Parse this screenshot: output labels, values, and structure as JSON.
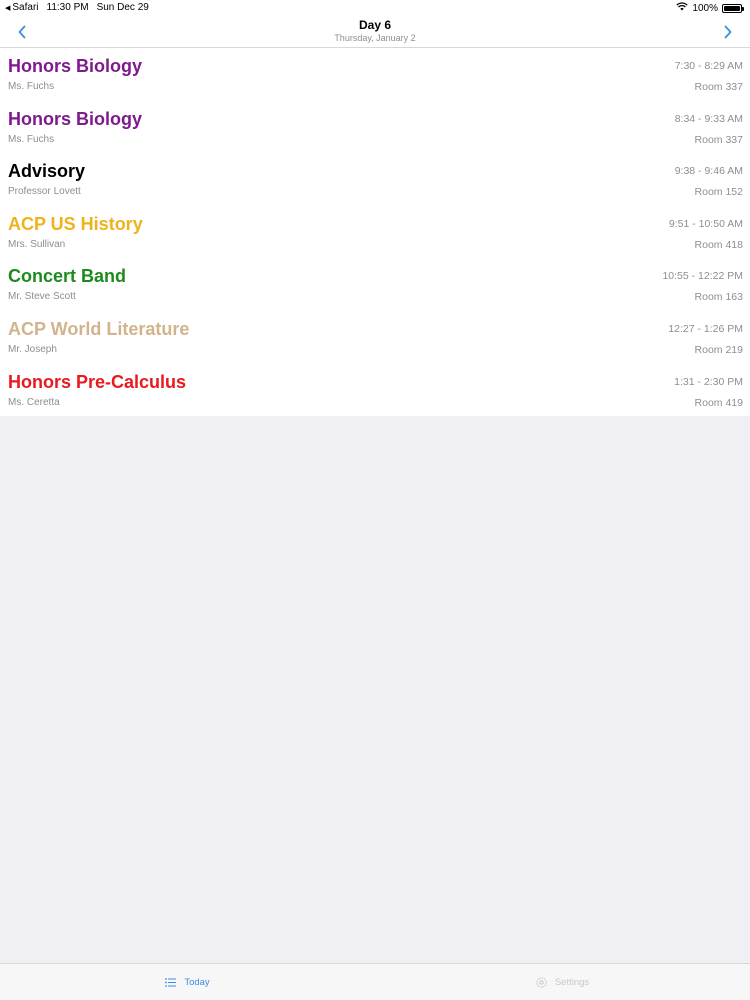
{
  "status_bar": {
    "back_app": "Safari",
    "time": "11:30 PM",
    "date": "Sun Dec 29",
    "battery": "100%",
    "battery_level": 1.0
  },
  "nav": {
    "title": "Day 6",
    "subtitle": "Thursday, January 2",
    "prev_icon": "chevron-left-icon",
    "next_icon": "chevron-right-icon",
    "accent_color": "#3f8de0"
  },
  "periods": [
    {
      "name": "Honors Biology",
      "teacher": "Ms. Fuchs",
      "time": "7:30 - 8:29 AM",
      "room": "Room 337",
      "color": "#7e1a8e"
    },
    {
      "name": "Honors Biology",
      "teacher": "Ms. Fuchs",
      "time": "8:34 - 9:33 AM",
      "room": "Room 337",
      "color": "#7e1a8e"
    },
    {
      "name": "Advisory",
      "teacher": "Professor Lovett",
      "time": "9:38 - 9:46 AM",
      "room": "Room 152",
      "color": "#000000"
    },
    {
      "name": "ACP US History",
      "teacher": "Mrs. Sullivan",
      "time": "9:51 - 10:50 AM",
      "room": "Room 418",
      "color": "#efb21b"
    },
    {
      "name": "Concert Band",
      "teacher": "Mr. Steve Scott",
      "time": "10:55 - 12:22 PM",
      "room": "Room 163",
      "color": "#1c8a1c"
    },
    {
      "name": "ACP World Literature",
      "teacher": "Mr. Joseph",
      "time": "12:27 - 1:26 PM",
      "room": "Room 219",
      "color": "#d1b48c"
    },
    {
      "name": "Honors Pre-Calculus",
      "teacher": "Ms. Ceretta",
      "time": "1:31 - 2:30 PM",
      "room": "Room 419",
      "color": "#e8191f"
    }
  ],
  "tabs": [
    {
      "label": "Today",
      "icon": "list-icon",
      "active": true
    },
    {
      "label": "Settings",
      "icon": "gear-icon",
      "active": false
    }
  ]
}
